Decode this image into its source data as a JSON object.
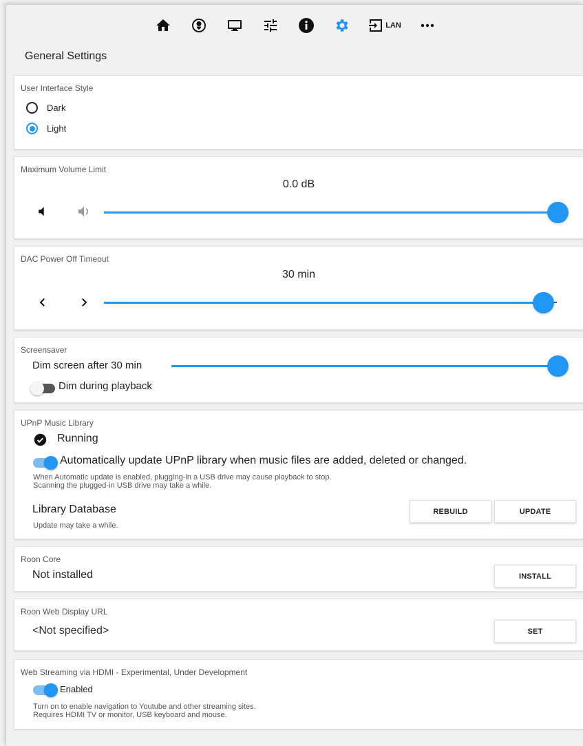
{
  "nav": {
    "items": [
      "home",
      "user",
      "display",
      "tune",
      "info",
      "settings",
      "input-lan",
      "more"
    ],
    "lan_label": "LAN",
    "active": "settings",
    "accent": "#2196f3"
  },
  "page_title": "General Settings",
  "ui_style": {
    "title": "User Interface Style",
    "options": [
      "Dark",
      "Light"
    ],
    "selected": "Light"
  },
  "volume": {
    "title": "Maximum Volume Limit",
    "value_text": "0.0 dB",
    "level": 1.0
  },
  "dac": {
    "title": "DAC Power Off Timeout",
    "value_text": "30 min",
    "level": 0.97
  },
  "screensaver": {
    "title": "Screensaver",
    "dim_label": "Dim screen after 30 min",
    "level": 1.0,
    "playback_label": "Dim during playback",
    "playback_on": false
  },
  "upnp": {
    "title": "UPnP Music Library",
    "status": "Running",
    "auto_label": "Automatically update UPnP library when music files are added, deleted or changed.",
    "auto_on": true,
    "note_line1": "When Automatic update is enabled, plugging-in a USB drive may cause playback to stop.",
    "note_line2": "Scanning the plugged-in USB drive may take a while.",
    "db_label": "Library Database",
    "db_note": "Update may take a while.",
    "rebuild_label": "REBUILD",
    "update_label": "UPDATE"
  },
  "roon_core": {
    "title": "Roon Core",
    "status": "Not installed",
    "install_label": "INSTALL"
  },
  "roon_url": {
    "title": "Roon Web Display URL",
    "value": "<Not specified>",
    "set_label": "SET"
  },
  "web_streaming": {
    "title": "Web Streaming via HDMI - Experimental, Under Development",
    "enabled_label": "Enabled",
    "enabled_on": true,
    "note_line1": "Turn on to enable navigation to Youtube and other streaming sites.",
    "note_line2": "Requires HDMI TV or monitor, USB keyboard and mouse."
  }
}
